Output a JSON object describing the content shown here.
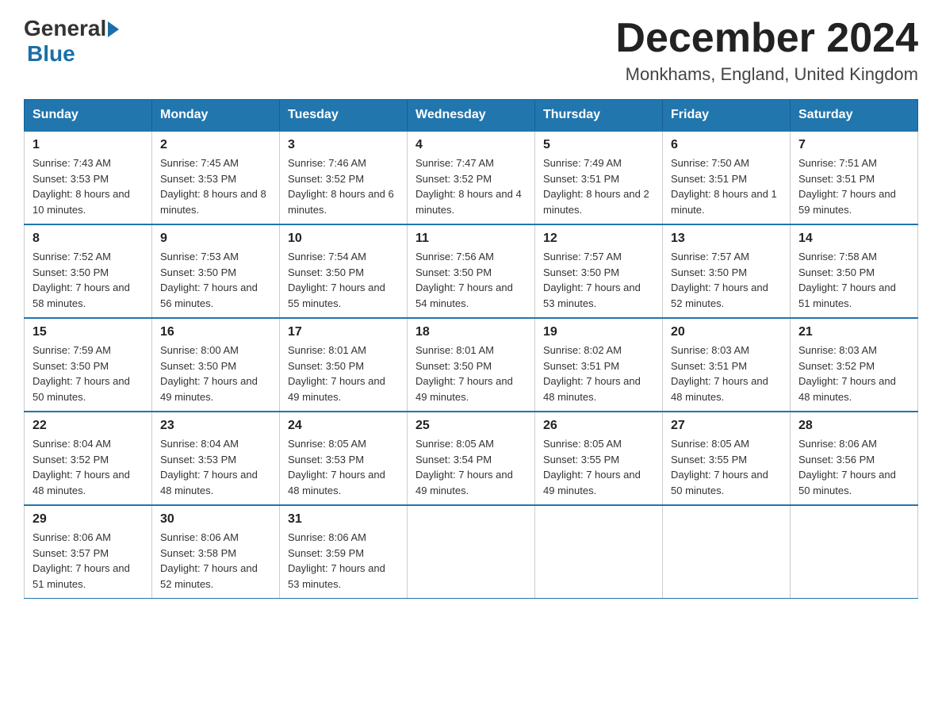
{
  "header": {
    "logo_general": "General",
    "logo_blue": "Blue",
    "month_year": "December 2024",
    "location": "Monkhams, England, United Kingdom"
  },
  "days_of_week": [
    "Sunday",
    "Monday",
    "Tuesday",
    "Wednesday",
    "Thursday",
    "Friday",
    "Saturday"
  ],
  "weeks": [
    [
      {
        "day": "1",
        "sunrise": "7:43 AM",
        "sunset": "3:53 PM",
        "daylight": "8 hours and 10 minutes."
      },
      {
        "day": "2",
        "sunrise": "7:45 AM",
        "sunset": "3:53 PM",
        "daylight": "8 hours and 8 minutes."
      },
      {
        "day": "3",
        "sunrise": "7:46 AM",
        "sunset": "3:52 PM",
        "daylight": "8 hours and 6 minutes."
      },
      {
        "day": "4",
        "sunrise": "7:47 AM",
        "sunset": "3:52 PM",
        "daylight": "8 hours and 4 minutes."
      },
      {
        "day": "5",
        "sunrise": "7:49 AM",
        "sunset": "3:51 PM",
        "daylight": "8 hours and 2 minutes."
      },
      {
        "day": "6",
        "sunrise": "7:50 AM",
        "sunset": "3:51 PM",
        "daylight": "8 hours and 1 minute."
      },
      {
        "day": "7",
        "sunrise": "7:51 AM",
        "sunset": "3:51 PM",
        "daylight": "7 hours and 59 minutes."
      }
    ],
    [
      {
        "day": "8",
        "sunrise": "7:52 AM",
        "sunset": "3:50 PM",
        "daylight": "7 hours and 58 minutes."
      },
      {
        "day": "9",
        "sunrise": "7:53 AM",
        "sunset": "3:50 PM",
        "daylight": "7 hours and 56 minutes."
      },
      {
        "day": "10",
        "sunrise": "7:54 AM",
        "sunset": "3:50 PM",
        "daylight": "7 hours and 55 minutes."
      },
      {
        "day": "11",
        "sunrise": "7:56 AM",
        "sunset": "3:50 PM",
        "daylight": "7 hours and 54 minutes."
      },
      {
        "day": "12",
        "sunrise": "7:57 AM",
        "sunset": "3:50 PM",
        "daylight": "7 hours and 53 minutes."
      },
      {
        "day": "13",
        "sunrise": "7:57 AM",
        "sunset": "3:50 PM",
        "daylight": "7 hours and 52 minutes."
      },
      {
        "day": "14",
        "sunrise": "7:58 AM",
        "sunset": "3:50 PM",
        "daylight": "7 hours and 51 minutes."
      }
    ],
    [
      {
        "day": "15",
        "sunrise": "7:59 AM",
        "sunset": "3:50 PM",
        "daylight": "7 hours and 50 minutes."
      },
      {
        "day": "16",
        "sunrise": "8:00 AM",
        "sunset": "3:50 PM",
        "daylight": "7 hours and 49 minutes."
      },
      {
        "day": "17",
        "sunrise": "8:01 AM",
        "sunset": "3:50 PM",
        "daylight": "7 hours and 49 minutes."
      },
      {
        "day": "18",
        "sunrise": "8:01 AM",
        "sunset": "3:50 PM",
        "daylight": "7 hours and 49 minutes."
      },
      {
        "day": "19",
        "sunrise": "8:02 AM",
        "sunset": "3:51 PM",
        "daylight": "7 hours and 48 minutes."
      },
      {
        "day": "20",
        "sunrise": "8:03 AM",
        "sunset": "3:51 PM",
        "daylight": "7 hours and 48 minutes."
      },
      {
        "day": "21",
        "sunrise": "8:03 AM",
        "sunset": "3:52 PM",
        "daylight": "7 hours and 48 minutes."
      }
    ],
    [
      {
        "day": "22",
        "sunrise": "8:04 AM",
        "sunset": "3:52 PM",
        "daylight": "7 hours and 48 minutes."
      },
      {
        "day": "23",
        "sunrise": "8:04 AM",
        "sunset": "3:53 PM",
        "daylight": "7 hours and 48 minutes."
      },
      {
        "day": "24",
        "sunrise": "8:05 AM",
        "sunset": "3:53 PM",
        "daylight": "7 hours and 48 minutes."
      },
      {
        "day": "25",
        "sunrise": "8:05 AM",
        "sunset": "3:54 PM",
        "daylight": "7 hours and 49 minutes."
      },
      {
        "day": "26",
        "sunrise": "8:05 AM",
        "sunset": "3:55 PM",
        "daylight": "7 hours and 49 minutes."
      },
      {
        "day": "27",
        "sunrise": "8:05 AM",
        "sunset": "3:55 PM",
        "daylight": "7 hours and 50 minutes."
      },
      {
        "day": "28",
        "sunrise": "8:06 AM",
        "sunset": "3:56 PM",
        "daylight": "7 hours and 50 minutes."
      }
    ],
    [
      {
        "day": "29",
        "sunrise": "8:06 AM",
        "sunset": "3:57 PM",
        "daylight": "7 hours and 51 minutes."
      },
      {
        "day": "30",
        "sunrise": "8:06 AM",
        "sunset": "3:58 PM",
        "daylight": "7 hours and 52 minutes."
      },
      {
        "day": "31",
        "sunrise": "8:06 AM",
        "sunset": "3:59 PM",
        "daylight": "7 hours and 53 minutes."
      },
      null,
      null,
      null,
      null
    ]
  ],
  "labels": {
    "sunrise": "Sunrise:",
    "sunset": "Sunset:",
    "daylight": "Daylight:"
  }
}
